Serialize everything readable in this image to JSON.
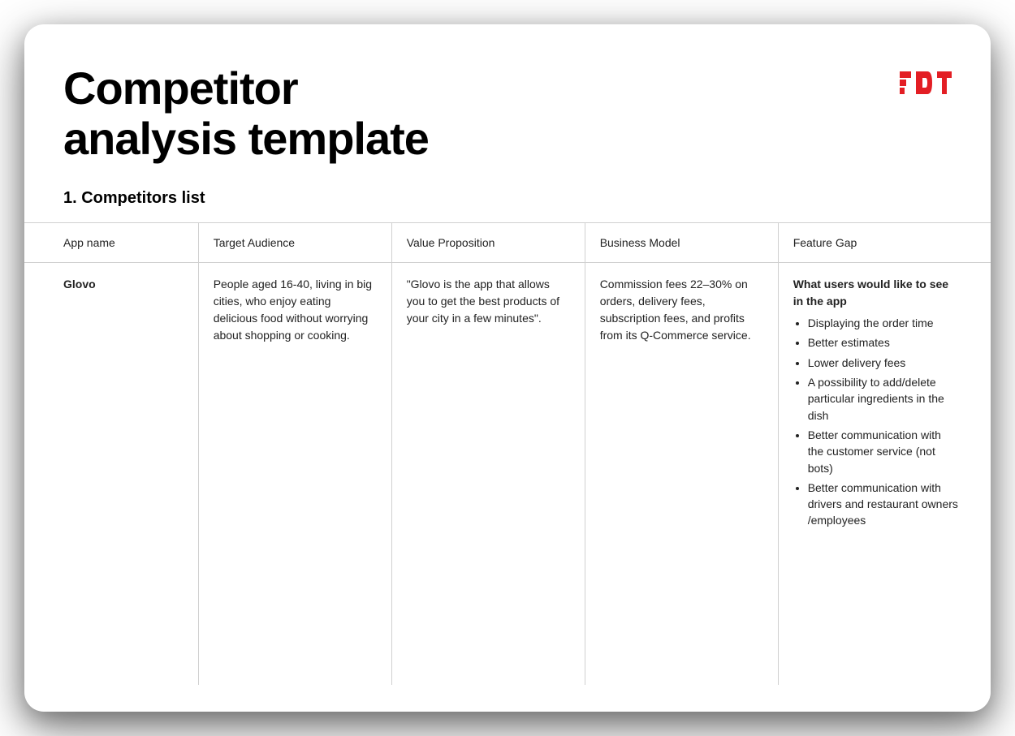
{
  "header": {
    "title": "Competitor analysis template",
    "logo_text": "FDT",
    "logo_color": "#e31e24"
  },
  "section": {
    "title": "1. Competitors list"
  },
  "table": {
    "headers": {
      "app_name": "App name",
      "target_audience": "Target Audience",
      "value_proposition": "Value Proposition",
      "business_model": "Business Model",
      "feature_gap": "Feature Gap"
    },
    "rows": [
      {
        "app_name": "Glovo",
        "target_audience": "People aged 16-40, living in big cities, who enjoy eating delicious food without worrying about shopping or cooking.",
        "value_proposition": "\"Glovo is the app that allows you to get the best products of your city in a few minutes\".",
        "business_model": "Commission fees 22–30% on orders, delivery fees, subscription fees, and profits from its Q-Commerce service.",
        "feature_gap": {
          "title": "What users would like to see in the app",
          "items": [
            "Displaying the order time",
            "Better estimates",
            "Lower delivery fees",
            "A possibility to add/delete particular ingredients in the dish",
            "Better communication with the customer service (not bots)",
            "Better communication with drivers and restaurant owners /employees"
          ]
        }
      }
    ]
  }
}
